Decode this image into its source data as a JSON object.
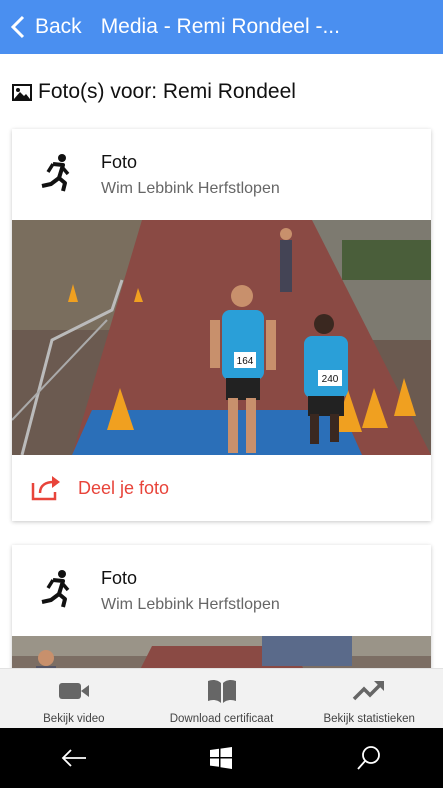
{
  "header": {
    "back_label": "Back",
    "title": "Media - Remi Rondeel -..."
  },
  "page": {
    "title": "Foto(s) voor: Remi Rondeel"
  },
  "cards": [
    {
      "title": "Foto",
      "subtitle": "Wim Lebbink Herfstlopen",
      "share_label": "Deel je foto",
      "bibs": [
        "164",
        "240"
      ]
    },
    {
      "title": "Foto",
      "subtitle": "Wim Lebbink Herfstlopen"
    }
  ],
  "bottom_bar": {
    "items": [
      {
        "label": "Bekijk video",
        "icon": "video-camera-icon"
      },
      {
        "label": "Download certificaat",
        "icon": "book-icon"
      },
      {
        "label": "Bekijk statistieken",
        "icon": "trending-up-icon"
      }
    ]
  },
  "colors": {
    "header_bg": "#4a8ff0",
    "share_accent": "#e8443a",
    "nav_bg": "#000000"
  }
}
